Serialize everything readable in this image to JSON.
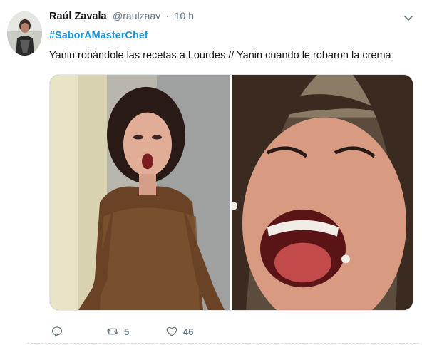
{
  "tweet": {
    "author_name": "Raúl Zavala",
    "author_handle": "@raulzaav",
    "separator": "·",
    "time": "10 h",
    "hashtag": "#SaborAMasterChef",
    "text": "Yanin robándole las recetas a Lourdes // Yanin cuando le robaron la crema"
  },
  "media": {
    "images": [
      {
        "subject": "surprised-woman-brown-dress"
      },
      {
        "subject": "laughing-woman-closeup"
      }
    ]
  },
  "actions": {
    "reply_icon": "reply-icon",
    "reply_count": "",
    "retweet_icon": "retweet-icon",
    "retweet_count": "5",
    "like_icon": "heart-icon",
    "like_count": "46"
  },
  "colors": {
    "link": "#1b95e0",
    "secondary_text": "#657786",
    "primary_text": "#14171a"
  }
}
